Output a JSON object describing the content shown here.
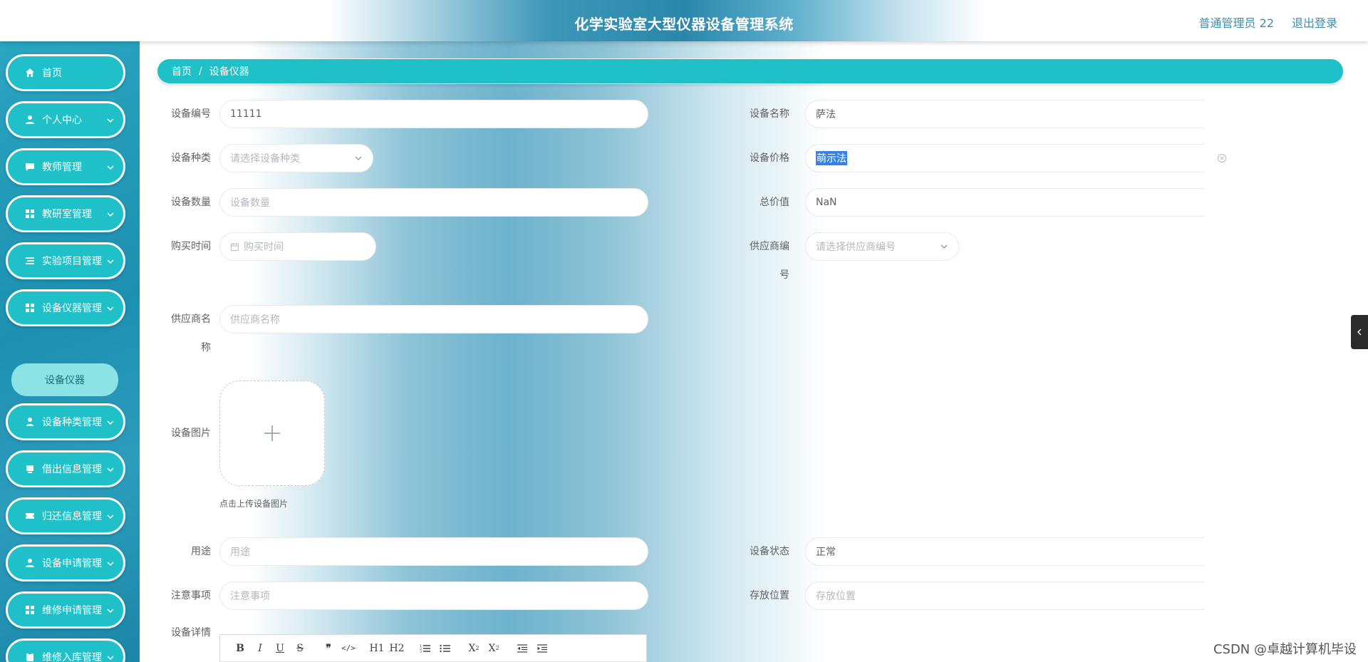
{
  "header": {
    "title": "化学实验室大型仪器设备管理系统",
    "user": "普通管理员 22",
    "logout": "退出登录"
  },
  "sidebar": {
    "items": [
      {
        "label": "首页",
        "icon": "home-icon"
      },
      {
        "label": "个人中心",
        "icon": "user-icon"
      },
      {
        "label": "教师管理",
        "icon": "chat-icon"
      },
      {
        "label": "教研室管理",
        "icon": "grid-icon"
      },
      {
        "label": "实验项目管理",
        "icon": "list-icon"
      },
      {
        "label": "设备仪器管理",
        "icon": "grid-icon"
      },
      {
        "label": "设备种类管理",
        "icon": "user-icon"
      },
      {
        "label": "借出信息管理",
        "icon": "box-icon"
      },
      {
        "label": "归还信息管理",
        "icon": "ticket-icon"
      },
      {
        "label": "设备申请管理",
        "icon": "user-icon"
      },
      {
        "label": "维修申请管理",
        "icon": "grid-icon"
      },
      {
        "label": "维修入库管理",
        "icon": "clipboard-icon"
      }
    ],
    "sub_active": "设备仪器"
  },
  "breadcrumb": {
    "home": "首页",
    "separator": "/",
    "current": "设备仪器"
  },
  "form": {
    "device_no": {
      "label": "设备编号",
      "value": "11111"
    },
    "device_name": {
      "label": "设备名称",
      "value": "萨法"
    },
    "device_type": {
      "label": "设备种类",
      "placeholder": "请选择设备种类"
    },
    "device_price": {
      "label": "设备价格",
      "value": "萌示法"
    },
    "device_qty": {
      "label": "设备数量",
      "placeholder": "设备数量"
    },
    "total_value": {
      "label": "总价值",
      "value": "NaN"
    },
    "purchase_time": {
      "label": "购买时间",
      "placeholder": "购买时间"
    },
    "supplier_no": {
      "label_line1": "供应商编",
      "label_line2": "号",
      "placeholder": "请选择供应商编号"
    },
    "supplier_name": {
      "label_line1": "供应商名",
      "label_line2": "称",
      "placeholder": "供应商名称"
    },
    "device_image": {
      "label": "设备图片",
      "hint": "点击上传设备图片"
    },
    "usage": {
      "label": "用途",
      "placeholder": "用途"
    },
    "device_status": {
      "label": "设备状态",
      "value": "正常"
    },
    "notes": {
      "label": "注意事项",
      "placeholder": "注意事项"
    },
    "storage": {
      "label": "存放位置",
      "placeholder": "存放位置"
    },
    "details": {
      "label": "设备详情"
    }
  },
  "editor_toolbar": [
    "B",
    "I",
    "U",
    "S",
    "❞",
    "</>",
    "H1",
    "H2",
    "ol",
    "ul",
    "X2",
    "X2",
    "outdent",
    "indent"
  ],
  "watermark": "CSDN @卓越计算机毕设",
  "colors": {
    "accent": "#1fc0c8",
    "header_text": "#3a8fb0"
  }
}
